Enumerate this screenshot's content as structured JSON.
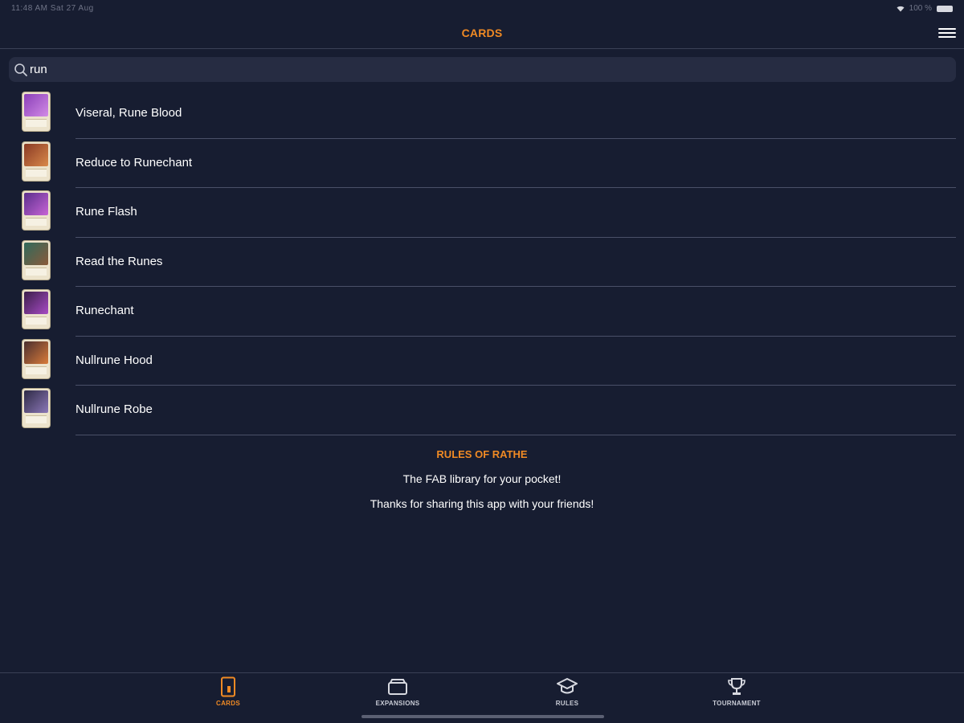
{
  "status_bar": {
    "time": "11:48 AM  Sat 27 Aug",
    "battery": "100 %"
  },
  "header": {
    "title": "CARDS"
  },
  "search": {
    "value": "run",
    "icon": "search-icon"
  },
  "cards": [
    {
      "name": "Viseral, Rune Blood",
      "art_color": "#8a3fb8",
      "art_color2": "#d28be6"
    },
    {
      "name": "Reduce to Runechant",
      "art_color": "#8a3a24",
      "art_color2": "#d9894b"
    },
    {
      "name": "Rune Flash",
      "art_color": "#5b2f8c",
      "art_color2": "#c764d6"
    },
    {
      "name": "Read the Runes",
      "art_color": "#2f6a5c",
      "art_color2": "#8a5a3a"
    },
    {
      "name": "Runechant",
      "art_color": "#3b1e4a",
      "art_color2": "#a74bc4"
    },
    {
      "name": "Nullrune Hood",
      "art_color": "#4a2f2f",
      "art_color2": "#d97b3a"
    },
    {
      "name": "Nullrune Robe",
      "art_color": "#2e2a45",
      "art_color2": "#8c78b8"
    }
  ],
  "footer": {
    "title": "RULES OF RATHE",
    "line1": "The FAB library for your pocket!",
    "line2": "Thanks for sharing this app with your friends!"
  },
  "tabs": [
    {
      "label": "CARDS",
      "icon": "card-icon",
      "active": true
    },
    {
      "label": "EXPANSIONS",
      "icon": "box-icon",
      "active": false
    },
    {
      "label": "RULES",
      "icon": "graduation-cap-icon",
      "active": false
    },
    {
      "label": "TOURNAMENT",
      "icon": "trophy-icon",
      "active": false
    }
  ],
  "colors": {
    "background": "#171d31",
    "accent": "#f08a24",
    "search_bg": "#262c42",
    "divider": "#4a5068"
  }
}
